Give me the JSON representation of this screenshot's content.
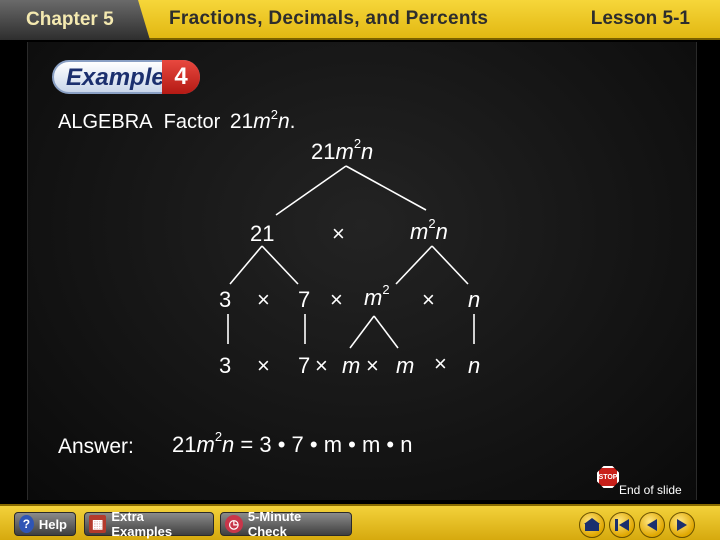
{
  "header": {
    "chapter": "Chapter 5",
    "title": "Fractions, Decimals, and Percents",
    "lesson": "Lesson 5-1"
  },
  "example": {
    "label": "Example",
    "number": "4"
  },
  "problem": {
    "prefix": "ALGEBRA",
    "verb": "Factor",
    "coef": "21",
    "var1": "m",
    "exp": "2",
    "var2": "n",
    "period": "."
  },
  "tree": {
    "root": {
      "coef": "21",
      "var1": "m",
      "exp": "2",
      "var2": "n"
    },
    "level1": {
      "left": "21",
      "op": "×",
      "right_var1": "m",
      "right_exp": "2",
      "right_var2": "n"
    },
    "level2": {
      "a": "3",
      "op1": "×",
      "b": "7",
      "op2": "×",
      "c_var": "m",
      "c_exp": "2",
      "op3": "×",
      "d": "n"
    },
    "level3": {
      "a": "3",
      "op1": "×",
      "b": "7",
      "op2": "×",
      "c": "m",
      "op3": "×",
      "d": "m",
      "op4": "×",
      "e": "n"
    }
  },
  "answer": {
    "label": "Answer:",
    "lhs_coef": "21",
    "lhs_var1": "m",
    "lhs_exp": "2",
    "lhs_var2": "n",
    "eq": " = ",
    "rhs": "3 • 7 • m • m • n"
  },
  "end_of_slide": "End of slide",
  "stop_text": "STOP",
  "toolbar": {
    "help": "Help",
    "extra_examples": "Extra Examples",
    "five_minute_check": "5-Minute Check"
  },
  "icons": {
    "help": "question-icon",
    "extra_examples": "extra-examples-icon",
    "five_minute_check": "clock-icon",
    "menu": "menu-icon",
    "first": "first-slide-icon",
    "prev": "previous-slide-icon",
    "next": "next-slide-icon"
  },
  "colors": {
    "header_bar": "#e9c21f",
    "toolbar": "#e9c21f",
    "panel": "#141414",
    "badge_red": "#c82a22",
    "badge_navy": "#1b2f6e"
  }
}
